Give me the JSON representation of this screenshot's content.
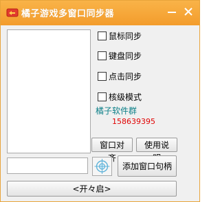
{
  "window": {
    "title": "橘子游戏多窗口同步器"
  },
  "options": [
    {
      "label": "鼠标同步",
      "checked": false
    },
    {
      "label": "键盘同步",
      "checked": false
    },
    {
      "label": "点击同步",
      "checked": false
    },
    {
      "label": "核级模式",
      "checked": false
    }
  ],
  "group": {
    "name": "橘子软件群",
    "number": "158639395"
  },
  "buttons": {
    "align_label": "窗口对齐",
    "help_label": "使用说明",
    "add_handle_label": "添加窗口句柄",
    "start_label": "<开々启>"
  },
  "handle_input": {
    "value": ""
  },
  "colors": {
    "titlebar": "#f39c2c",
    "group_name": "#0c7f88",
    "group_number": "#e00000"
  }
}
